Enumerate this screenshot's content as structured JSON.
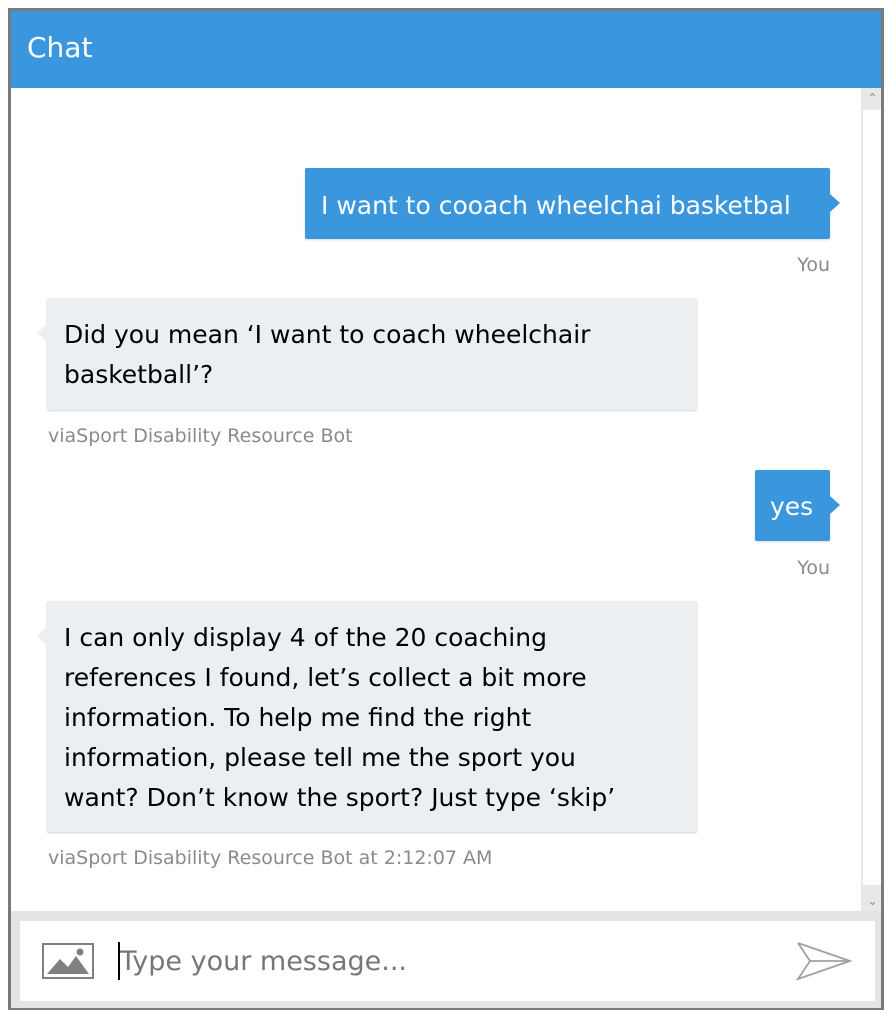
{
  "header": {
    "title": "Chat"
  },
  "messages": [
    {
      "from": "user",
      "text": "I want to cooach wheelchai basketbal",
      "meta": "You"
    },
    {
      "from": "bot",
      "lines": [
        "Did you mean ‘I want to coach wheelchair",
        "basketball’?"
      ],
      "meta": "viaSport Disability Resource Bot"
    },
    {
      "from": "user",
      "text": "yes",
      "meta": "You"
    },
    {
      "from": "bot",
      "lines": [
        "I can only display 4 of the 20 coaching",
        "references I found, let’s collect a bit more",
        "information. To help me find the right",
        "information, please tell me the sport you",
        "want? Don’t know the sport? Just type ‘skip’"
      ],
      "meta": "viaSport Disability Resource Bot at 2:12:07 AM"
    }
  ],
  "composer": {
    "placeholder": "Type your message...",
    "value": "",
    "upload_icon": "image-icon",
    "send_icon": "send-icon"
  },
  "scrollbar": {
    "up_glyph": "⌃",
    "down_glyph": "⌄"
  },
  "colors": {
    "accent": "#3a96dd",
    "bot_bubble": "#eceff2",
    "meta_text": "#8a8a8a"
  }
}
